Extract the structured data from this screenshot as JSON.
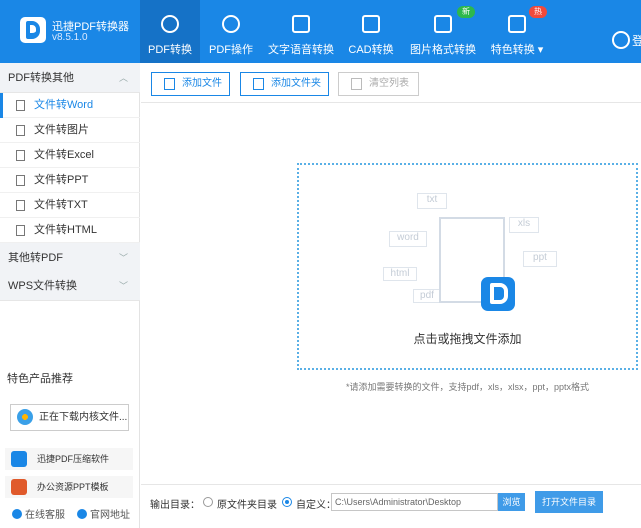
{
  "app": {
    "name": "迅捷PDF转换器",
    "version": "v8.5.1.0"
  },
  "tabs": [
    {
      "label": "PDF转换",
      "active": true
    },
    {
      "label": "PDF操作"
    },
    {
      "label": "文字语音转换"
    },
    {
      "label": "CAD转换"
    },
    {
      "label": "图片格式转换",
      "badge": "新"
    },
    {
      "label": "特色转换 ▾",
      "badge": "热"
    }
  ],
  "login": "登",
  "sidebar": {
    "section1": "PDF转换其他",
    "items": [
      "文件转Word",
      "文件转图片",
      "文件转Excel",
      "文件转PPT",
      "文件转TXT",
      "文件转HTML"
    ],
    "section2": "其他转PDF",
    "section3": "WPS文件转换",
    "rec_title": "特色产品推荐",
    "downloading": "正在下载内核文件...",
    "rec1": "迅捷PDF压缩软件",
    "rec2": "办公资源PPT模板",
    "online_service": "在线客服",
    "website": "官网地址"
  },
  "toolbar": {
    "add_file": "添加文件",
    "add_folder": "添加文件夹",
    "clear_list": "清空列表"
  },
  "drop": {
    "text": "点击或拖拽文件添加",
    "tags": [
      "txt",
      "xls",
      "word",
      "ppt",
      "html",
      "pdf"
    ],
    "hint": "*请添加需要转换的文件，支持pdf，xls，xlsx，ppt，pptx格式"
  },
  "output": {
    "label": "输出目录：",
    "opt_original": "原文件夹目录",
    "opt_custom": "自定义：",
    "path": "C:\\Users\\Administrator\\Desktop",
    "browse": "浏览",
    "open": "打开文件目录"
  },
  "colors": {
    "primary": "#1a87e6",
    "new_badge": "#2db84d",
    "hot_badge": "#f04a3c"
  }
}
